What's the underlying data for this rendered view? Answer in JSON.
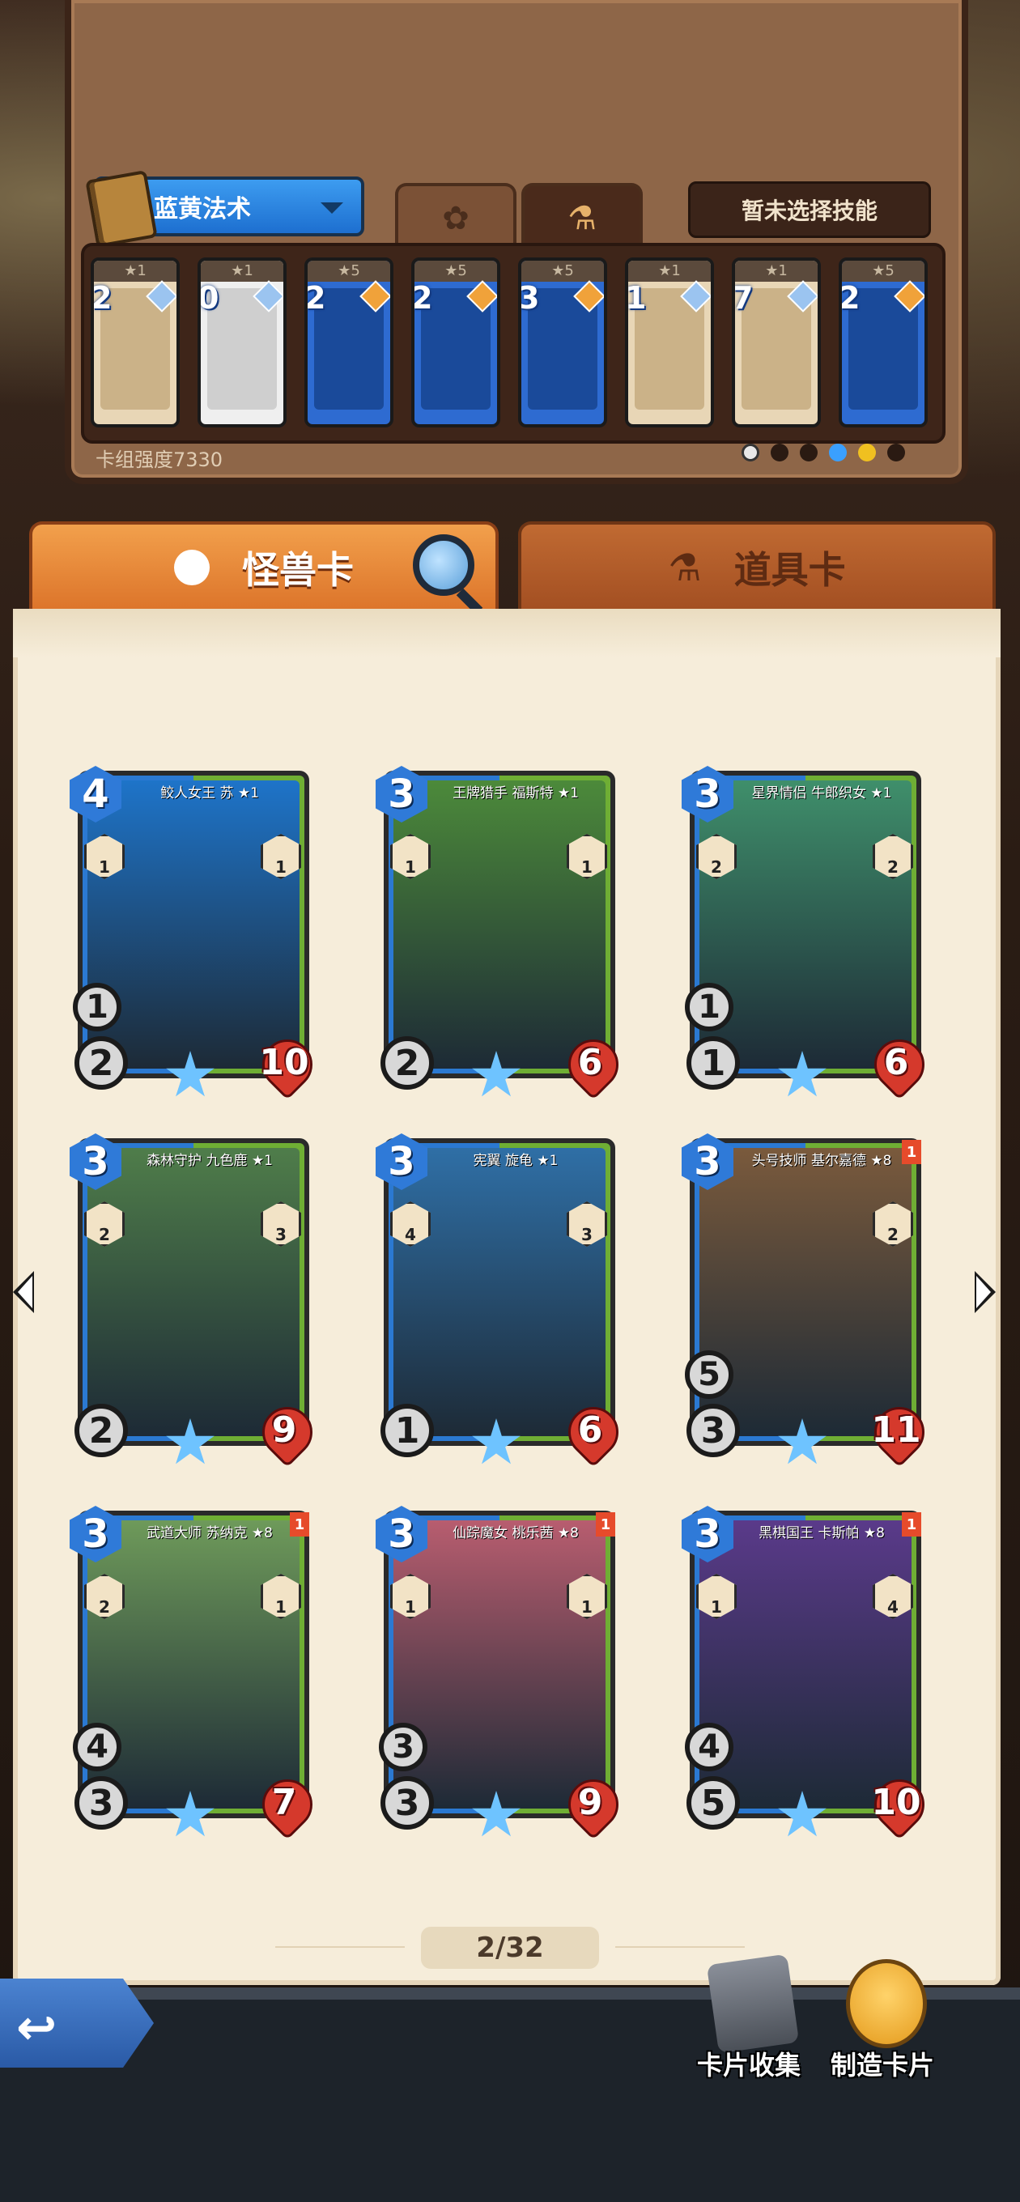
{
  "deck": {
    "name": "蓝黄法术",
    "skill_button": "暂未选择技能",
    "strength_label": "卡组强度7330",
    "cards": [
      {
        "cost": "2",
        "stars": "★1",
        "color": "beige",
        "icon": "shuriken-icon"
      },
      {
        "cost": "0",
        "stars": "★1",
        "color": "white",
        "icon": "coin-icon"
      },
      {
        "cost": "2",
        "stars": "★5",
        "color": "blue",
        "icon": "orb-staff-icon"
      },
      {
        "cost": "2",
        "stars": "★5",
        "color": "blue",
        "icon": "orb-staff-icon"
      },
      {
        "cost": "3",
        "stars": "★5",
        "color": "blue",
        "icon": "spell-scroll-icon"
      },
      {
        "cost": "1",
        "stars": "★1",
        "color": "beige",
        "icon": "egg-icon"
      },
      {
        "cost": "7",
        "stars": "★1",
        "color": "beige",
        "icon": "armor-icon"
      },
      {
        "cost": "2",
        "stars": "★5",
        "color": "blue",
        "icon": "winged-staff-icon"
      }
    ]
  },
  "tabs": {
    "monster": "怪兽卡",
    "item": "道具卡"
  },
  "monster_cards": [
    {
      "name": "鲛人女王 苏 ★1",
      "cost": "4",
      "atk": "2",
      "hp": "10",
      "extra": "1",
      "abil_l": "1",
      "abil_r": "1",
      "color": "#1e74c9"
    },
    {
      "name": "王牌猎手 福斯特 ★1",
      "cost": "3",
      "atk": "2",
      "hp": "6",
      "extra": "",
      "abil_l": "1",
      "abil_r": "1",
      "color": "#4c8a3a"
    },
    {
      "name": "星界情侣 牛郎织女 ★1",
      "cost": "3",
      "atk": "1",
      "hp": "6",
      "extra": "1",
      "abil_l": "2",
      "abil_r": "2",
      "color": "#3f8f6b"
    },
    {
      "name": "森林守护 九色鹿 ★1",
      "cost": "3",
      "atk": "2",
      "hp": "9",
      "extra": "",
      "abil_l": "2",
      "abil_r": "3",
      "color": "#4f7d4a"
    },
    {
      "name": "宪翼 旋龟 ★1",
      "cost": "3",
      "atk": "1",
      "hp": "6",
      "extra": "",
      "abil_l": "4",
      "abil_r": "3",
      "color": "#2f6fa6"
    },
    {
      "name": "头号技师 基尔嘉德 ★8",
      "cost": "3",
      "atk": "3",
      "hp": "11",
      "extra": "5",
      "abil_l": "",
      "abil_r": "2",
      "color": "#7a5a3c",
      "flag": "1"
    },
    {
      "name": "武道大师 苏纳克 ★8",
      "cost": "3",
      "atk": "3",
      "hp": "7",
      "extra": "4",
      "abil_l": "2",
      "abil_r": "1",
      "color": "#6e9a5a",
      "flag": "1"
    },
    {
      "name": "仙踪魔女 桃乐茜 ★8",
      "cost": "3",
      "atk": "3",
      "hp": "9",
      "extra": "3",
      "abil_l": "1",
      "abil_r": "1",
      "color": "#b85d6f",
      "flag": "1"
    },
    {
      "name": "黑棋国王 卡斯帕 ★8",
      "cost": "3",
      "atk": "5",
      "hp": "10",
      "extra": "4",
      "abil_l": "1",
      "abil_r": "4",
      "color": "#5a3a8a",
      "flag": "1"
    }
  ],
  "pagination": "2/32",
  "bottom": {
    "collect_label": "卡片收集",
    "craft_label": "制造卡片"
  }
}
